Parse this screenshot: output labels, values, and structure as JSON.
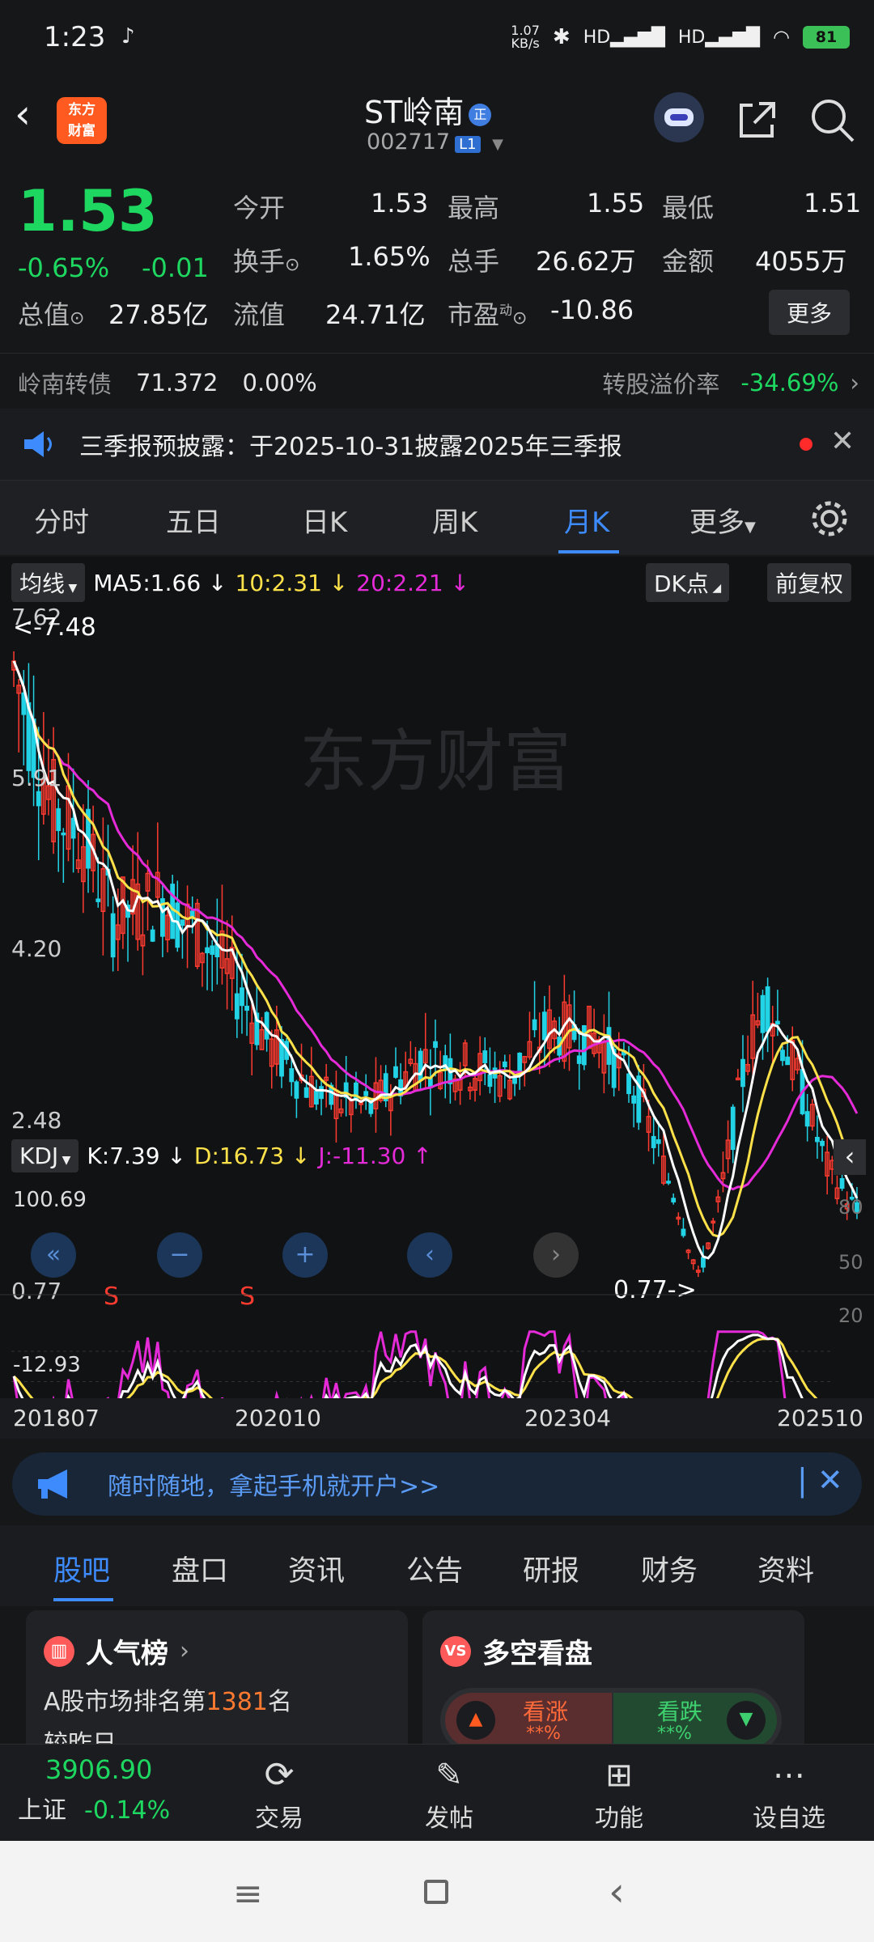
{
  "status": {
    "time": "1:23",
    "net": "1.07\nKB/s",
    "battery": "81"
  },
  "header": {
    "logo_text": "东方\n财富",
    "title": "ST岭南",
    "zheng": "正",
    "code": "002717",
    "level": "L1"
  },
  "quote": {
    "price": "1.53",
    "pct": "-0.65%",
    "chg": "-0.01",
    "open_label": "今开",
    "open": "1.53",
    "high_label": "最高",
    "high": "1.55",
    "low_label": "最低",
    "low": "1.51",
    "turnover_label": "换手",
    "turnover": "1.65%",
    "volume_label": "总手",
    "volume": "26.62万",
    "amount_label": "金额",
    "amount": "4055万",
    "mktcap_label": "总值",
    "mktcap": "27.85亿",
    "float_label": "流值",
    "float": "24.71亿",
    "pe_label": "市盈",
    "pe_sup": "动",
    "pe": "-10.86",
    "more": "更多",
    "bond_label": "岭南转债",
    "bond_price": "71.372",
    "bond_pct": "0.00%",
    "premium_label": "转股溢价率",
    "premium": "-34.69%"
  },
  "notice": {
    "text": "三季报预披露：于2025-10-31披露2025年三季报"
  },
  "tabs": [
    "分时",
    "五日",
    "日K",
    "周K",
    "月K",
    "更多"
  ],
  "chart": {
    "ma_selector": "均线",
    "ma5": "MA5:1.66 ↓",
    "ma10": "10:2.31 ↓",
    "ma20": "20:2.21 ↓",
    "dk": "DK点",
    "fq": "前复权",
    "y_labels": [
      "7.62",
      "5.91",
      "4.20",
      "2.48",
      "0.77"
    ],
    "high_marker": "<-7.48",
    "low_marker": "0.77->",
    "watermark": "东方财富",
    "kdj_selector": "KDJ",
    "k": "K:7.39 ↓",
    "d": "D:16.73 ↓",
    "j": "J:-11.30 ↑",
    "kdj_y": [
      "100.69",
      "-12.93"
    ],
    "kdj_right": [
      "80",
      "50",
      "20"
    ],
    "dates": [
      "201807",
      "202010",
      "202304",
      "202510"
    ],
    "s_marks": [
      "S",
      "S"
    ]
  },
  "promo": {
    "text": "随时随地，拿起手机就开户>>"
  },
  "bottom_tabs": [
    "股吧",
    "盘口",
    "资讯",
    "公告",
    "研报",
    "财务",
    "资料"
  ],
  "cards": {
    "left_title": "人气榜",
    "left_line1_pre": "A股市场排名第",
    "left_rank": "1381",
    "left_line1_post": "名",
    "left_line2": "较昨日",
    "right_title": "多空看盘",
    "bull": "看涨",
    "bear": "看跌",
    "stars": "**%"
  },
  "dock": {
    "index_value": "3906.90",
    "index_name": "上证",
    "index_pct": "-0.14%",
    "items": [
      "交易",
      "发帖",
      "功能",
      "设自选"
    ]
  }
}
